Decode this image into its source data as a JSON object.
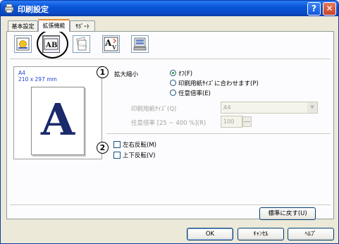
{
  "window": {
    "title": "印刷設定",
    "help_label": "?",
    "close_label": "✕"
  },
  "tabs": [
    {
      "label": "基本設定"
    },
    {
      "label": "拡張機能"
    },
    {
      "label": "ｻﾎﾟｰﾄ"
    }
  ],
  "toolbar": {
    "tools": [
      {
        "icon": "watermark-tool-icon"
      },
      {
        "icon": "scaling-tool-icon",
        "selected": true
      },
      {
        "icon": "copy-tool-icon"
      },
      {
        "icon": "reverse-print-tool-icon"
      },
      {
        "icon": "device-options-tool-icon"
      }
    ]
  },
  "preview": {
    "paper_name": "A4",
    "paper_dims": "210 x 297 mm",
    "letter": "A"
  },
  "callouts": {
    "one": "1",
    "two": "2"
  },
  "scaling": {
    "label": "拡大縮小",
    "options": [
      {
        "label": "ｵﾌ(F)",
        "checked": true
      },
      {
        "label": "印刷用紙ｻｲｽﾞに合わせます(P)",
        "checked": false
      },
      {
        "label": "任意倍率(E)",
        "checked": false
      }
    ],
    "paper_size_label": "印刷用紙ｻｲｽﾞ(Q)",
    "paper_size_value": "A4",
    "ratio_label": "任意倍率 [25 ~ 400 %](R)",
    "ratio_value": "100"
  },
  "mirror": {
    "options": [
      {
        "label": "左右反転(M)",
        "checked": false
      },
      {
        "label": "上下反転(V)",
        "checked": false
      }
    ]
  },
  "buttons": {
    "default_label": "標準に戻す(U)",
    "ok_label": "OK",
    "cancel_label": "ｷｬﾝｾﾙ",
    "help_label": "ﾍﾙﾌﾟ"
  }
}
